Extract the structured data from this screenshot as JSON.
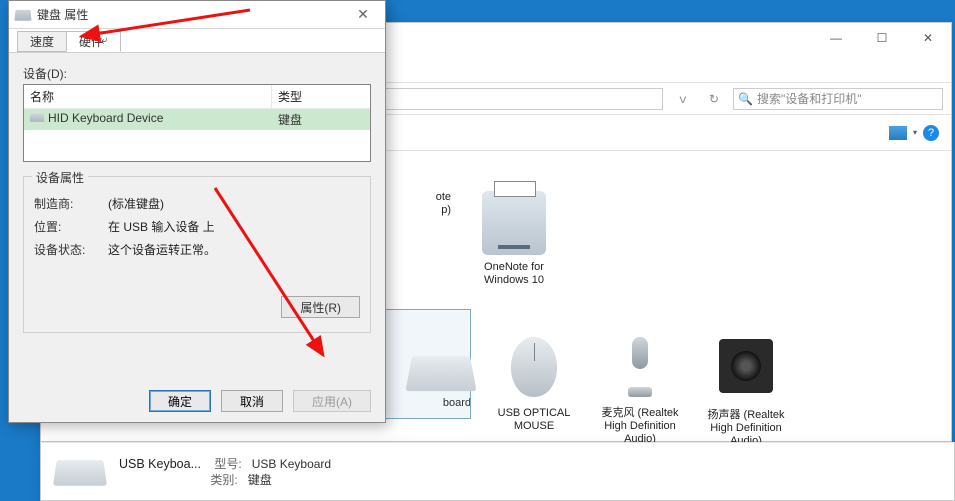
{
  "dialog": {
    "title": "键盘 属性",
    "tabs": {
      "speed": "速度",
      "hardware": "硬件",
      "cursor": "⤶"
    },
    "devices_label": "设备(D):",
    "columns": {
      "name": "名称",
      "type": "类型"
    },
    "rows": [
      {
        "name": "HID Keyboard Device",
        "type": "键盘"
      }
    ],
    "group_title": "设备属性",
    "props": {
      "maker_key": "制造商:",
      "maker_val": "(标准键盘)",
      "loc_key": "位置:",
      "loc_val": "在 USB 输入设备 上",
      "stat_key": "设备状态:",
      "stat_val": "这个设备运转正常。"
    },
    "properties_btn": "属性(R)",
    "ok": "确定",
    "cancel": "取消",
    "apply": "应用(A)"
  },
  "explorer": {
    "search_placeholder": "搜索\"设备和打印机\"",
    "printers": [
      {
        "name": "OneNote for Windows 10",
        "half1": "ote",
        "half2": "p)"
      }
    ],
    "devices": [
      {
        "name_l1": "board",
        "name_l2": ""
      },
      {
        "name_l1": "USB OPTICAL",
        "name_l2": "MOUSE"
      },
      {
        "name_l1": "麦克风 (Realtek",
        "name_l2": "High Definition",
        "name_l3": "Audio)"
      },
      {
        "name_l1": "扬声器 (Realtek",
        "name_l2": "High Definition",
        "name_l3": "Audio)"
      }
    ]
  },
  "details": {
    "title": "USB Keyboa...",
    "model_key": "型号:",
    "model_val": "USB Keyboard",
    "cat_key": "类别:",
    "cat_val": "键盘"
  }
}
